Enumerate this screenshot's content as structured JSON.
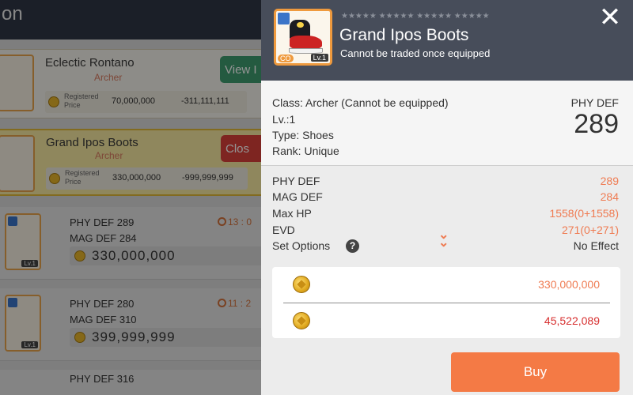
{
  "background": {
    "header_title": "on",
    "cards": [
      {
        "name": "Eclectic Rontano",
        "class": "Archer",
        "registered_label": "Registered Price",
        "price": "70,000,000",
        "diff": "-311,111,111",
        "button": "View I"
      },
      {
        "name": "Grand Ipos Boots",
        "class": "Archer",
        "registered_label": "Registered Price",
        "price": "330,000,000",
        "diff": "-999,999,999",
        "button": "Clos"
      }
    ],
    "rows": [
      {
        "stat1": "PHY DEF 289",
        "stat2": "MAG DEF 284",
        "price": "330,000,000",
        "time": "13 : 0",
        "level": "Lv.1"
      },
      {
        "stat1": "PHY DEF 280",
        "stat2": "MAG DEF 310",
        "price": "399,999,999",
        "time": "11 : 2",
        "level": "Lv.1"
      },
      {
        "stat1": "PHY DEF 316"
      }
    ]
  },
  "item": {
    "name": "Grand Ipos Boots",
    "subtitle": "Cannot be traded once equipped",
    "stars": "★★★★★ ★★★★★ ★★★★★ ★★★★★",
    "badge": "CO",
    "level": "Lv.1",
    "colors": {
      "header": "#474d5a",
      "accent": "#f47a45",
      "stat": "#ef7b52",
      "price_red": "#d72f2f"
    }
  },
  "info": {
    "class_line": "Class: Archer (Cannot be equipped)",
    "level_line": "Lv.:1",
    "type_line": "Type: Shoes",
    "rank_line": "Rank: Unique",
    "phy_def_label": "PHY DEF",
    "phy_def_value": "289"
  },
  "stats": [
    {
      "name": "PHY DEF",
      "value": "289"
    },
    {
      "name": "MAG DEF",
      "value": "284"
    },
    {
      "name": "Max HP",
      "value": "1558(0+1558)"
    },
    {
      "name": "EVD",
      "value": "271(0+271)"
    },
    {
      "name": "Set Options",
      "value": "No Effect"
    }
  ],
  "prices": {
    "listing": "330,000,000",
    "balance": "45,522,089"
  },
  "actions": {
    "close_glyph": "✕",
    "buy_label": "Buy",
    "help_glyph": "?",
    "expand_glyph": "⌄⌄"
  }
}
